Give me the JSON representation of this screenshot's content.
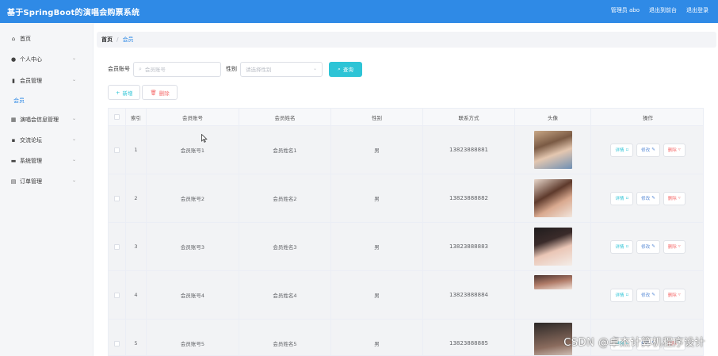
{
  "app": {
    "title": "基于SpringBoot的演唱会购票系统"
  },
  "header": {
    "links": [
      "管理员 abo",
      "退出到前台",
      "退出登录"
    ]
  },
  "sidebar": {
    "items": [
      {
        "label": "首页",
        "icon": "home-icon",
        "chevron": false
      },
      {
        "label": "个人中心",
        "icon": "user-icon",
        "chevron": true
      },
      {
        "label": "会员管理",
        "icon": "chart-icon",
        "chevron": true
      },
      {
        "label": "演唱会信息管理",
        "icon": "building-icon",
        "chevron": true
      },
      {
        "label": "交流论坛",
        "icon": "grid-icon",
        "chevron": true
      },
      {
        "label": "系统管理",
        "icon": "system-icon",
        "chevron": true
      },
      {
        "label": "订单管理",
        "icon": "order-icon",
        "chevron": true
      }
    ],
    "active_sub": "会员"
  },
  "breadcrumb": {
    "home": "首页",
    "separator": "/",
    "current": "会员"
  },
  "search": {
    "account_label": "会员账号",
    "account_placeholder": "会员账号",
    "gender_label": "性别",
    "gender_placeholder": "请选择性别",
    "query_label": "查询"
  },
  "actions": {
    "add_label": "新增",
    "delete_label": "删除"
  },
  "table": {
    "headers": [
      "",
      "索引",
      "会员账号",
      "会员姓名",
      "性别",
      "联系方式",
      "头像",
      "操作"
    ],
    "rows": [
      {
        "index": "1",
        "account": "会员账号1",
        "name": "会员姓名1",
        "gender": "男",
        "phone": "13823888881"
      },
      {
        "index": "2",
        "account": "会员账号2",
        "name": "会员姓名2",
        "gender": "男",
        "phone": "13823888882"
      },
      {
        "index": "3",
        "account": "会员账号3",
        "name": "会员姓名3",
        "gender": "男",
        "phone": "13823888883"
      },
      {
        "index": "4",
        "account": "会员账号4",
        "name": "会员姓名4",
        "gender": "男",
        "phone": "13823888884"
      },
      {
        "index": "5",
        "account": "会员账号5",
        "name": "会员姓名5",
        "gender": "男",
        "phone": "13823888885"
      }
    ],
    "op_labels": {
      "view": "详情",
      "edit": "修改",
      "delete": "删除"
    }
  },
  "watermark": "CSDN @卓杰计算机程序设计",
  "colors": {
    "header_bg": "#2f8ae6",
    "accent": "#2ec4d6",
    "danger": "#f56c6c",
    "sidebar_bg": "#f5f6f8"
  }
}
